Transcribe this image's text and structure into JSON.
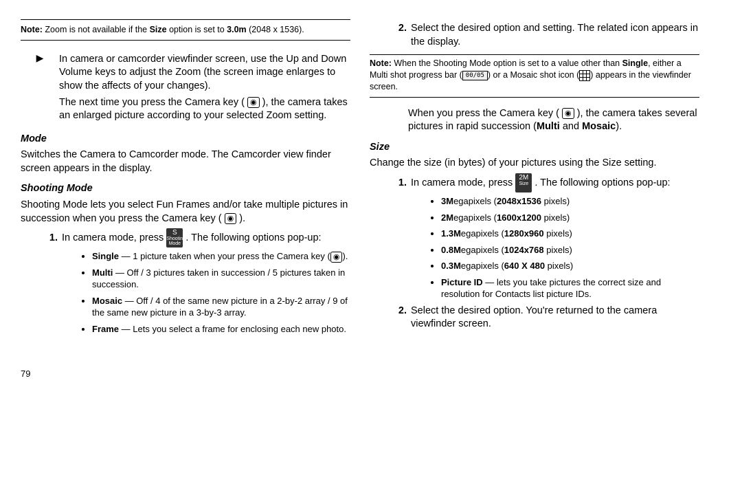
{
  "left": {
    "note1": {
      "label": "Note:",
      "text_a": " Zoom is not available if the ",
      "size": "Size",
      "text_b": " option is set to ",
      "val": "3.0m",
      "px": " (2048 x 1536)."
    },
    "p1": "In camera or camcorder viewfinder screen, use the Up and Down Volume keys to adjust the Zoom (the screen image enlarges to show the affects of your changes).",
    "p2a": "The next time you press the Camera key (",
    "p2b": "), the camera takes an enlarged picture according to your selected Zoom setting.",
    "mode_title": "Mode",
    "mode_text": "Switches the Camera to Camcorder mode. The Camcorder view finder screen appears in the display.",
    "shoot_title": "Shooting Mode",
    "shoot_text_a": "Shooting Mode lets you select Fun Frames and/or take multiple pictures in succession when you press the Camera key (",
    "shoot_text_b": ").",
    "step1a": "In camera mode, press ",
    "step1b": ". The following options pop-up:",
    "shootbox_top": "S",
    "shootbox_bot": "Shooting Mode",
    "bullets": {
      "single_a": "Single",
      "single_b": " — 1 picture taken when your press the Camera key (",
      "single_c": ").",
      "multi_a": "Multi",
      "multi_b": " — Off / 3 pictures taken in succession / 5 pictures taken in succession.",
      "mosaic_a": "Mosaic",
      "mosaic_b": " — Off / 4 of the same new picture in a 2-by-2 array / 9 of the same new picture in a 3-by-3 array.",
      "frame_a": "Frame",
      "frame_b": " — Lets you select a frame for enclosing each new photo."
    },
    "page": "79"
  },
  "right": {
    "step2": "Select the desired option and setting. The related icon appears in the display.",
    "note2": {
      "label": "Note:",
      "a": " When the Shooting Mode option is set to a value other than ",
      "single": "Single",
      "b": ", either a Multi shot progress bar (",
      "prog": "00/05",
      "c": ") or a Mosaic shot icon (",
      "d": ") appears in the viewfinder screen."
    },
    "p1a": "When you press the Camera key (",
    "p1b": "), the camera takes several pictures in rapid succession (",
    "multi": "Multi",
    "and": " and ",
    "mosaic": "Mosaic",
    "p1c": ").",
    "size_title": "Size",
    "size_text": "Change the size (in bytes) of your pictures using the Size setting.",
    "step1a": "In camera mode, press ",
    "step1b": ". The following options pop-up:",
    "sizebox_top": "2M",
    "sizebox_bot": "Size",
    "opts": {
      "a1": "3M",
      "a2": "egapixels (",
      "a3": "2048x1536",
      "a4": " pixels)",
      "b1": "2M",
      "b2": "egapixels (",
      "b3": "1600x1200",
      "b4": " pixels)",
      "c1": "1.3M",
      "c2": "egapixels (",
      "c3": "1280x960",
      "c4": " pixels)",
      "d1": "0.8M",
      "d2": "egapixels (",
      "d3": "1024x768",
      "d4": " pixels)",
      "e1": "0.3M",
      "e2": "egapixels (",
      "e3": "640 X 480",
      "e4": " pixels)",
      "f1": "Picture ID",
      "f2": " — lets you take pictures the correct size and resolution for Contacts list picture IDs."
    },
    "step2b": "Select the desired option. You're returned to the camera viewfinder screen."
  }
}
